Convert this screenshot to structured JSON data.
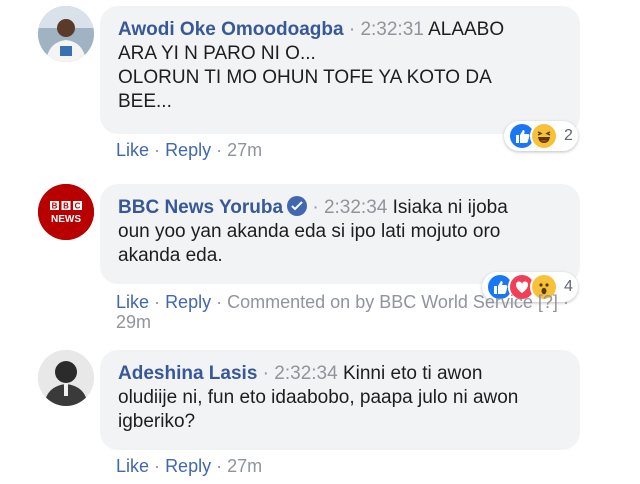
{
  "comments": [
    {
      "author": "Awodi Oke Omoodoagba",
      "time": "2:32:31",
      "text_lines": [
        "ALAABO",
        "ARA YI N PARO NI O...",
        "OLORUN TI MO OHUN TOFE YA KOTO DA",
        "BEE..."
      ],
      "like": "Like",
      "reply": "Reply",
      "age": "27m",
      "reaction_count": "2",
      "reactions": [
        "like-icon",
        "haha-icon"
      ]
    },
    {
      "author": "BBC News Yoruba",
      "time": "2:32:34",
      "text_lines": [
        "Isiaka ni ijoba",
        "oun yoo yan akanda eda si ipo lati mojuto oro",
        "akanda eda."
      ],
      "like": "Like",
      "reply": "Reply",
      "commented_on": "Commented on by BBC World Service [?]",
      "age": "29m",
      "reaction_count": "4",
      "reactions": [
        "like-icon",
        "love-icon",
        "wow-icon"
      ],
      "avatar_text_top": "BBC",
      "avatar_text_bottom": "NEWS"
    },
    {
      "author": "Adeshina Lasis",
      "time": "2:32:34",
      "text_lines": [
        "Kinni eto ti awon",
        "oludiije ni, fun eto idaabobo, paapa julo ni awon",
        "igberiko?"
      ],
      "like": "Like",
      "reply": "Reply",
      "age": "27m"
    }
  ],
  "separator": "·",
  "colors": {
    "author": "#385898",
    "link": "#4267b2",
    "meta": "#90949c",
    "bubble": "#f2f3f5",
    "bbc_red": "#b80000"
  }
}
